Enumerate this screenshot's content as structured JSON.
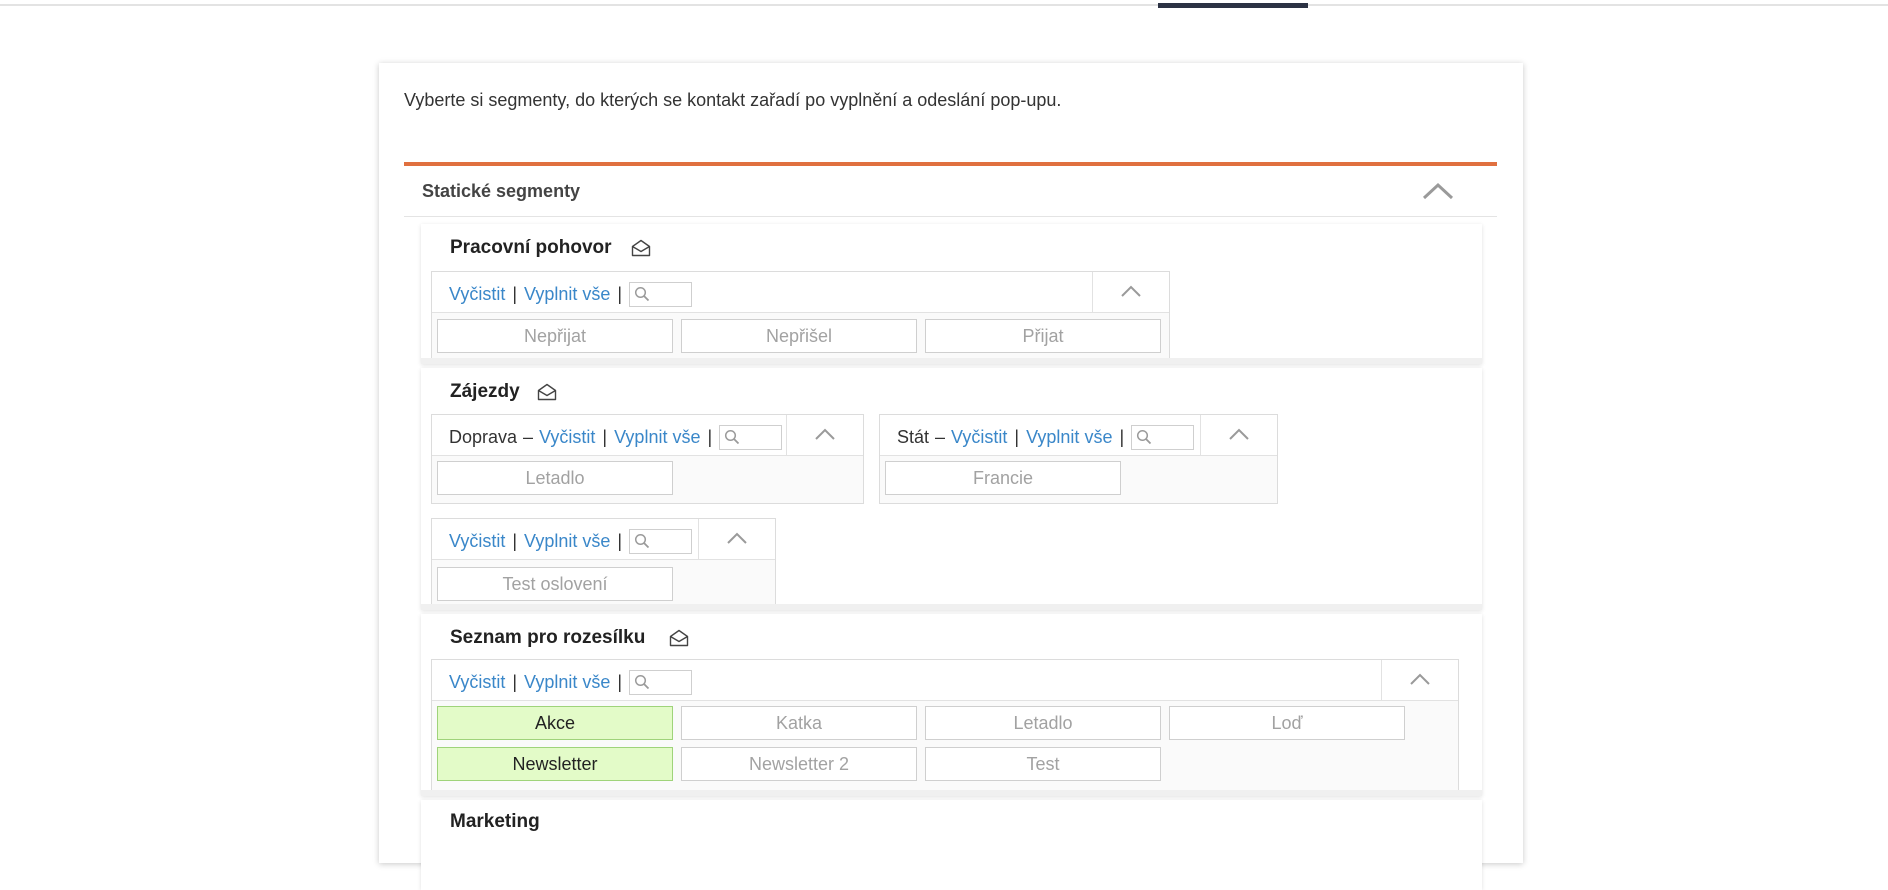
{
  "intro_text": "Vyberte si segmenty, do kterých se kontakt zařadí po vyplnění a odeslání pop-upu.",
  "section": {
    "title": "Statické segmenty",
    "toggle_icon": "chevron-up-icon"
  },
  "controls": {
    "clear_label": "Vyčistit",
    "fill_label": "Vyplnit vše",
    "separator": "|",
    "dash": "–",
    "search_icon": "search-icon",
    "collapse_icon": "chevron-up-icon"
  },
  "groups": [
    {
      "title": "Pracovní pohovor",
      "icon": "envelope-open-icon",
      "boxes": [
        {
          "category": "",
          "options": [
            {
              "label": "Nepřijat",
              "selected": false
            },
            {
              "label": "Nepřišel",
              "selected": false
            },
            {
              "label": "Přijat",
              "selected": false
            }
          ]
        }
      ]
    },
    {
      "title": "Zájezdy",
      "icon": "envelope-open-icon",
      "boxes": [
        {
          "category": "Doprava",
          "options": [
            {
              "label": "Letadlo",
              "selected": false
            }
          ]
        },
        {
          "category": "Stát",
          "options": [
            {
              "label": "Francie",
              "selected": false
            }
          ]
        },
        {
          "category": "",
          "options": [
            {
              "label": "Test oslovení",
              "selected": false
            }
          ]
        }
      ]
    },
    {
      "title": "Seznam pro rozesílku",
      "icon": "envelope-open-icon",
      "boxes": [
        {
          "category": "",
          "options": [
            {
              "label": "Akce",
              "selected": true
            },
            {
              "label": "Katka",
              "selected": false
            },
            {
              "label": "Letadlo",
              "selected": false
            },
            {
              "label": "Loď",
              "selected": false
            },
            {
              "label": "Newsletter",
              "selected": true
            },
            {
              "label": "Newsletter 2",
              "selected": false
            },
            {
              "label": "Test",
              "selected": false
            }
          ]
        }
      ]
    },
    {
      "title": "Marketing",
      "icon": "",
      "boxes": []
    }
  ]
}
